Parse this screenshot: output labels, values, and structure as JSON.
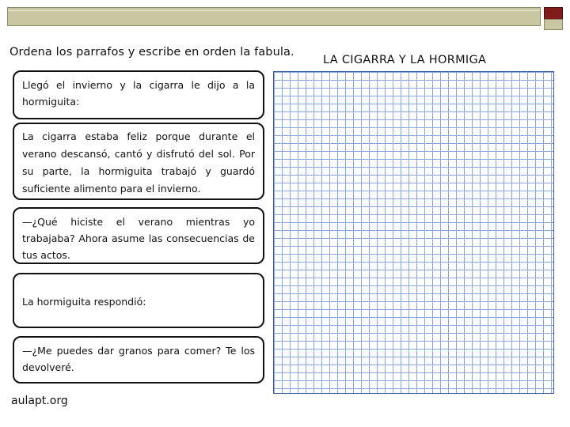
{
  "worksheet": {
    "instruction": "Ordena los parrafos y escribe en orden la fabula.",
    "fable_title": "LA CIGARRA Y LA HORMIGA",
    "paragraphs": [
      "Llegó el invierno y la cigarra le dijo a la hormiguita:",
      "La cigarra estaba feliz porque durante el verano descansó, cantó y disfrutó del sol. Por su parte, la hormiguita trabajó y guardó suficiente alimento para el invierno.",
      "—¿Qué hiciste el verano mientras yo trabajaba? Ahora asume las consecuencias de tus actos.",
      "La hormiguita respondió:",
      "—¿Me puedes dar granos para comer? Te los devolveré."
    ],
    "footer": "aulapt.org"
  },
  "colors": {
    "top_bar": "#c8c7a2",
    "accent_square": "#7f1c1c",
    "grid_line": "#8ea6d8",
    "grid_border": "#3a56a6"
  }
}
